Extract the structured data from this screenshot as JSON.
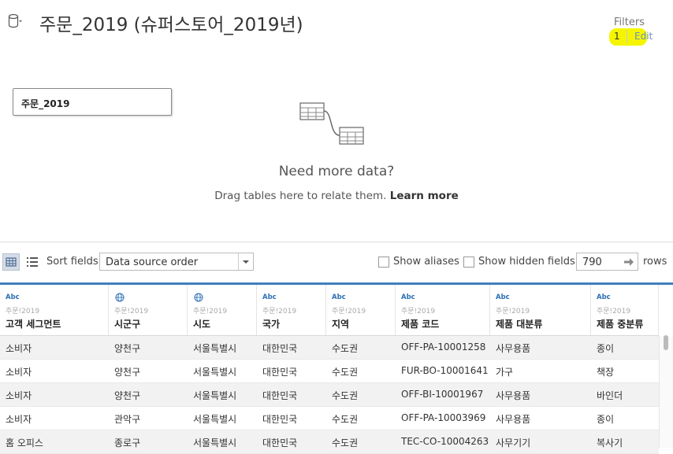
{
  "header": {
    "title": "주문_2019 (슈퍼스토어_2019년)",
    "filters_label": "Filters",
    "filters_count": "1",
    "filters_edit": "Edit",
    "datasource_icon": "database-icon"
  },
  "canvas": {
    "table_name": "주문_2019",
    "need_more_title": "Need more data?",
    "drag_hint": "Drag tables here to relate them.",
    "learn_more": "Learn more",
    "relate_icon": "tables-relationship-icon"
  },
  "toolbar": {
    "sort_label": "Sort fields",
    "sort_value": "Data source order",
    "show_aliases": "Show aliases",
    "show_hidden": "Show hidden fields",
    "rows_value": "790",
    "rows_label": "rows"
  },
  "grid": {
    "columns": [
      {
        "type": "Abc",
        "source": "주문!2019",
        "name": "고객 세그먼트"
      },
      {
        "type": "geo",
        "source": "주문!2019",
        "name": "시군구"
      },
      {
        "type": "geo",
        "source": "주문!2019",
        "name": "시도"
      },
      {
        "type": "Abc",
        "source": "주문!2019",
        "name": "국가"
      },
      {
        "type": "Abc",
        "source": "주문!2019",
        "name": "지역"
      },
      {
        "type": "Abc",
        "source": "주문!2019",
        "name": "제품 코드"
      },
      {
        "type": "Abc",
        "source": "주문!2019",
        "name": "제품 대분류"
      },
      {
        "type": "Abc",
        "source": "주문!2019",
        "name": "제품 중분류"
      }
    ],
    "rows": [
      [
        "소비자",
        "양천구",
        "서울특별시",
        "대한민국",
        "수도권",
        "OFF-PA-10001258",
        "사무용품",
        "종이"
      ],
      [
        "소비자",
        "양천구",
        "서울특별시",
        "대한민국",
        "수도권",
        "FUR-BO-10001641",
        "가구",
        "책장"
      ],
      [
        "소비자",
        "양천구",
        "서울특별시",
        "대한민국",
        "수도권",
        "OFF-BI-10001967",
        "사무용품",
        "바인더"
      ],
      [
        "소비자",
        "관악구",
        "서울특별시",
        "대한민국",
        "수도권",
        "OFF-PA-10003969",
        "사무용품",
        "종이"
      ],
      [
        "홈 오피스",
        "종로구",
        "서울특별시",
        "대한민국",
        "수도권",
        "TEC-CO-10004263",
        "사무기기",
        "복사기"
      ]
    ]
  },
  "colors": {
    "accent_blue": "#3f7ec0",
    "highlight": "#f5f500",
    "type_blue": "#2c6fb4"
  }
}
